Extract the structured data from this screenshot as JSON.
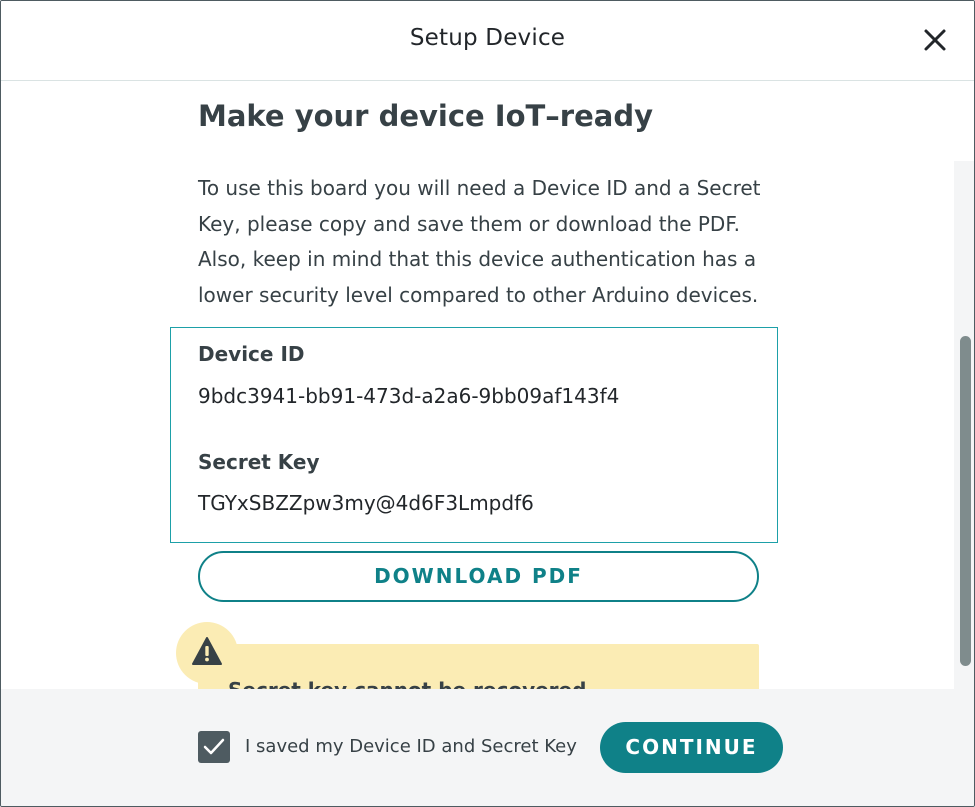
{
  "modal": {
    "title": "Setup Device"
  },
  "main": {
    "heading": "Make your device IoT–ready",
    "description": "To use this board you will need a Device ID and a Secret Key, please copy and save them or download the PDF. Also, keep in mind that this device authentication has a lower security level compared to other Arduino devices."
  },
  "credentials": {
    "device_id_label": "Device ID",
    "device_id_value": "9bdc3941-bb91-473d-a2a6-9bb09af143f4",
    "secret_key_label": "Secret Key",
    "secret_key_value": "TGYxSBZZpw3my@4d6F3Lmpdf6"
  },
  "download_label": "DOWNLOAD PDF",
  "warning": {
    "text": "Secret key cannot be recovered"
  },
  "footer": {
    "checkbox_checked": true,
    "checkbox_label": "I saved my Device ID and Secret Key",
    "continue_label": "CONTINUE"
  },
  "colors": {
    "accent": "#0f8188",
    "border": "#1da0a8",
    "warning_bg": "#fbecb4",
    "text": "#374146"
  },
  "icons": {
    "close": "close-icon",
    "warning": "warning-icon",
    "check": "checkmark-icon"
  }
}
